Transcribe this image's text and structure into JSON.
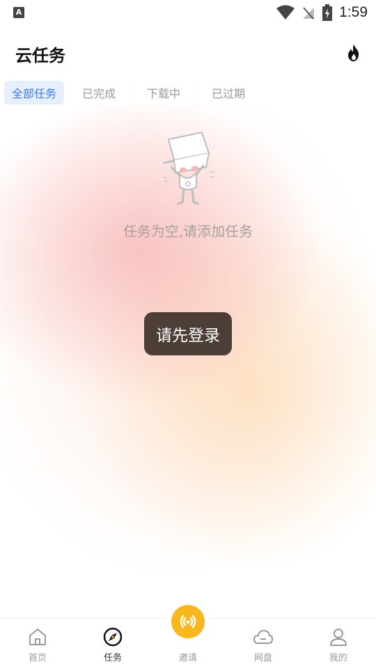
{
  "status_bar": {
    "left_badge": "A",
    "time": "1:59"
  },
  "header": {
    "title": "云任务"
  },
  "tabs": [
    {
      "label": "全部任务",
      "active": true
    },
    {
      "label": "已完成",
      "active": false
    },
    {
      "label": "下载中",
      "active": false
    },
    {
      "label": "已过期",
      "active": false
    }
  ],
  "empty_state": {
    "message": "任务为空,请添加任务"
  },
  "toast": {
    "text": "请先登录"
  },
  "bottom_nav": {
    "items": [
      {
        "label": "首页",
        "icon": "home-icon"
      },
      {
        "label": "任务",
        "icon": "compass-icon"
      },
      {
        "label": "邀请",
        "icon": "broadcast-icon"
      },
      {
        "label": "网盘",
        "icon": "cloud-icon"
      },
      {
        "label": "我的",
        "icon": "person-icon"
      }
    ]
  },
  "colors": {
    "accent": "#3d7be0",
    "invite": "#f8b81d",
    "toast_bg": "#4d3e38",
    "fire": "#111111"
  }
}
